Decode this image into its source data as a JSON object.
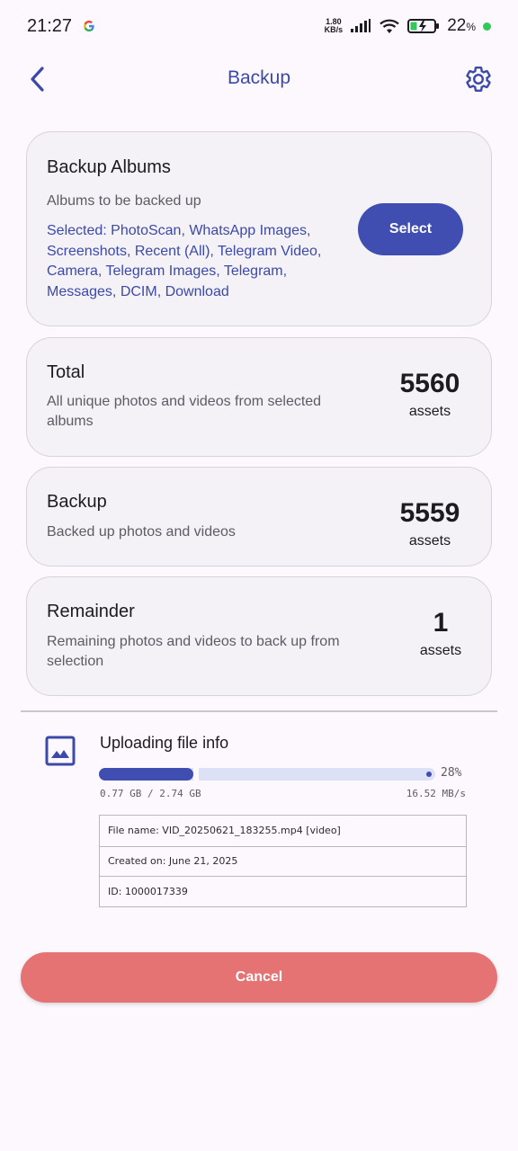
{
  "status_bar": {
    "time": "21:27",
    "net_speed_value": "1.80",
    "net_speed_unit": "KB/s",
    "battery": "22",
    "battery_unit": "%"
  },
  "app_bar": {
    "title": "Backup"
  },
  "albums_card": {
    "title": "Backup Albums",
    "subtitle": "Albums to be backed up",
    "selected": "Selected: PhotoScan, WhatsApp Images, Screenshots, Recent (All), Telegram Video, Camera, Telegram Images, Telegram, Messages, DCIM, Download",
    "select_label": "Select"
  },
  "total_card": {
    "title": "Total",
    "description": "All unique photos and videos from selected albums",
    "count": "5560",
    "unit": "assets"
  },
  "backup_card": {
    "title": "Backup",
    "description": "Backed up photos and videos",
    "count": "5559",
    "unit": "assets"
  },
  "remainder_card": {
    "title": "Remainder",
    "description": "Remaining photos and videos to back up from selection",
    "count": "1",
    "unit": "assets"
  },
  "upload": {
    "title": "Uploading file info",
    "progress_fraction": 0.28,
    "progress_text": "28%",
    "transferred": "0.77 GB / 2.74 GB",
    "speed": "16.52 MB/s",
    "file_name": "File name: VID_20250621_183255.mp4 [video]",
    "created_on": "Created on: June 21, 2025",
    "id": "ID: 1000017339"
  },
  "cancel_label": "Cancel",
  "colors": {
    "primary": "#3f4eb0",
    "cancel": "#e57373",
    "background": "#fcf8fd"
  }
}
